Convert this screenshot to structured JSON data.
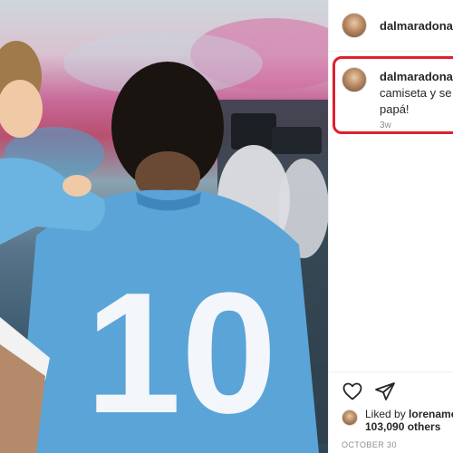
{
  "post": {
    "username": "dalmaradona",
    "caption_line1": "camiseta y se fe",
    "caption_line2": "papá!",
    "time_ago": "3w",
    "liked_by_prefix": "Liked by",
    "liked_by_user": "lorenamer",
    "others_count": "103,090 others",
    "date": "OCTOBER 30"
  },
  "photo": {
    "jersey_number": "10",
    "jersey_color": "#5aa4d8"
  },
  "colors": {
    "highlight": "#e0202e",
    "verified": "#3897f0",
    "muted_text": "#8e8e8e"
  },
  "icons": {
    "verified": "verified-badge-icon",
    "like": "heart-icon",
    "share": "paper-plane-icon"
  }
}
